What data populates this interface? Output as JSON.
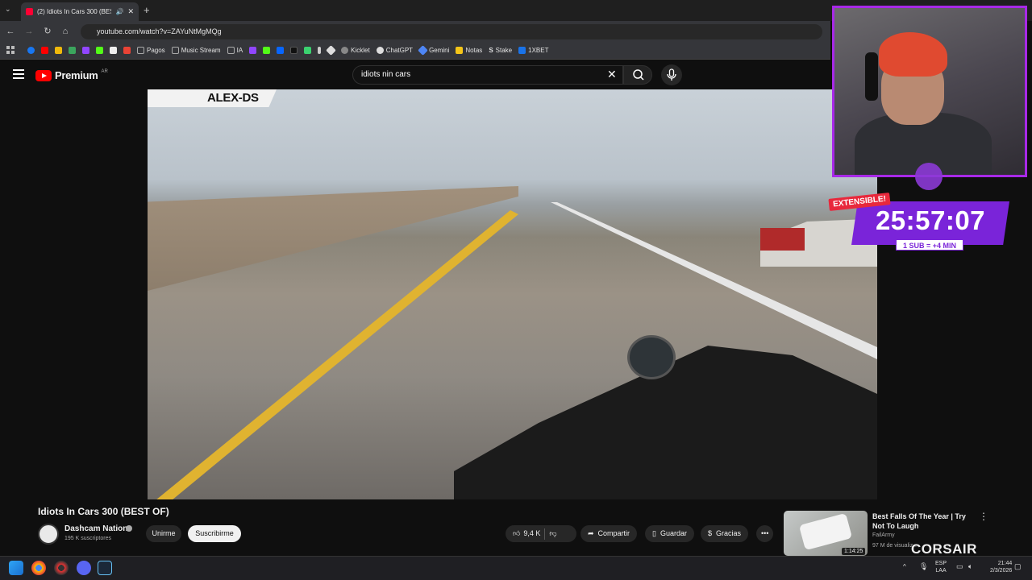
{
  "browser": {
    "tab_title": "(2) Idiots In Cars 300 (BEST",
    "url": "youtube.com/watch?v=ZAYuNtMgMQg",
    "bookmarks": [
      {
        "label": "Pagos",
        "color": "#8a8a8a"
      },
      {
        "label": "Music Stream",
        "color": "#8a8a8a"
      },
      {
        "label": "IA",
        "color": "#8a8a8a"
      },
      {
        "label": "Kicklet",
        "color": "#53fc18"
      },
      {
        "label": "ChatGPT",
        "color": "#10a37f"
      },
      {
        "label": "Gemini",
        "color": "#4e86f5"
      },
      {
        "label": "Notas",
        "color": "#f5c518"
      },
      {
        "label": "Stake",
        "color": "#b0b7c3"
      },
      {
        "label": "1XBET",
        "color": "#1a73e8"
      }
    ]
  },
  "youtube": {
    "logo_text": "Premium",
    "country_code": "AR",
    "search_query": "idiots nin cars"
  },
  "video": {
    "overlay_name": "ALEX-DS",
    "title": "Idiots In Cars 300 (BEST OF)",
    "channel": "Dashcam Nation",
    "subscribers": "195 K suscriptores",
    "join_label": "Unirme",
    "subscribe_label": "Suscribirme",
    "likes": "9,4 K",
    "share_label": "Compartir",
    "save_label": "Guardar",
    "thanks_label": "Gracias"
  },
  "stream": {
    "extensible_label": "EXTENSIBLE!",
    "timer": "25:57:07",
    "sub_info": "1 SUB = +4 MIN",
    "sponsor": "CORSAIR"
  },
  "recommendation": {
    "title": "Best Falls Of The Year | Try Not To Laugh",
    "channel": "FailArmy",
    "views": "97 M de visualiz...",
    "duration": "1:14:25"
  },
  "taskbar": {
    "lang_top": "ESP",
    "lang_bottom": "LAA",
    "time": "21:44",
    "date": "2/3/2026"
  }
}
